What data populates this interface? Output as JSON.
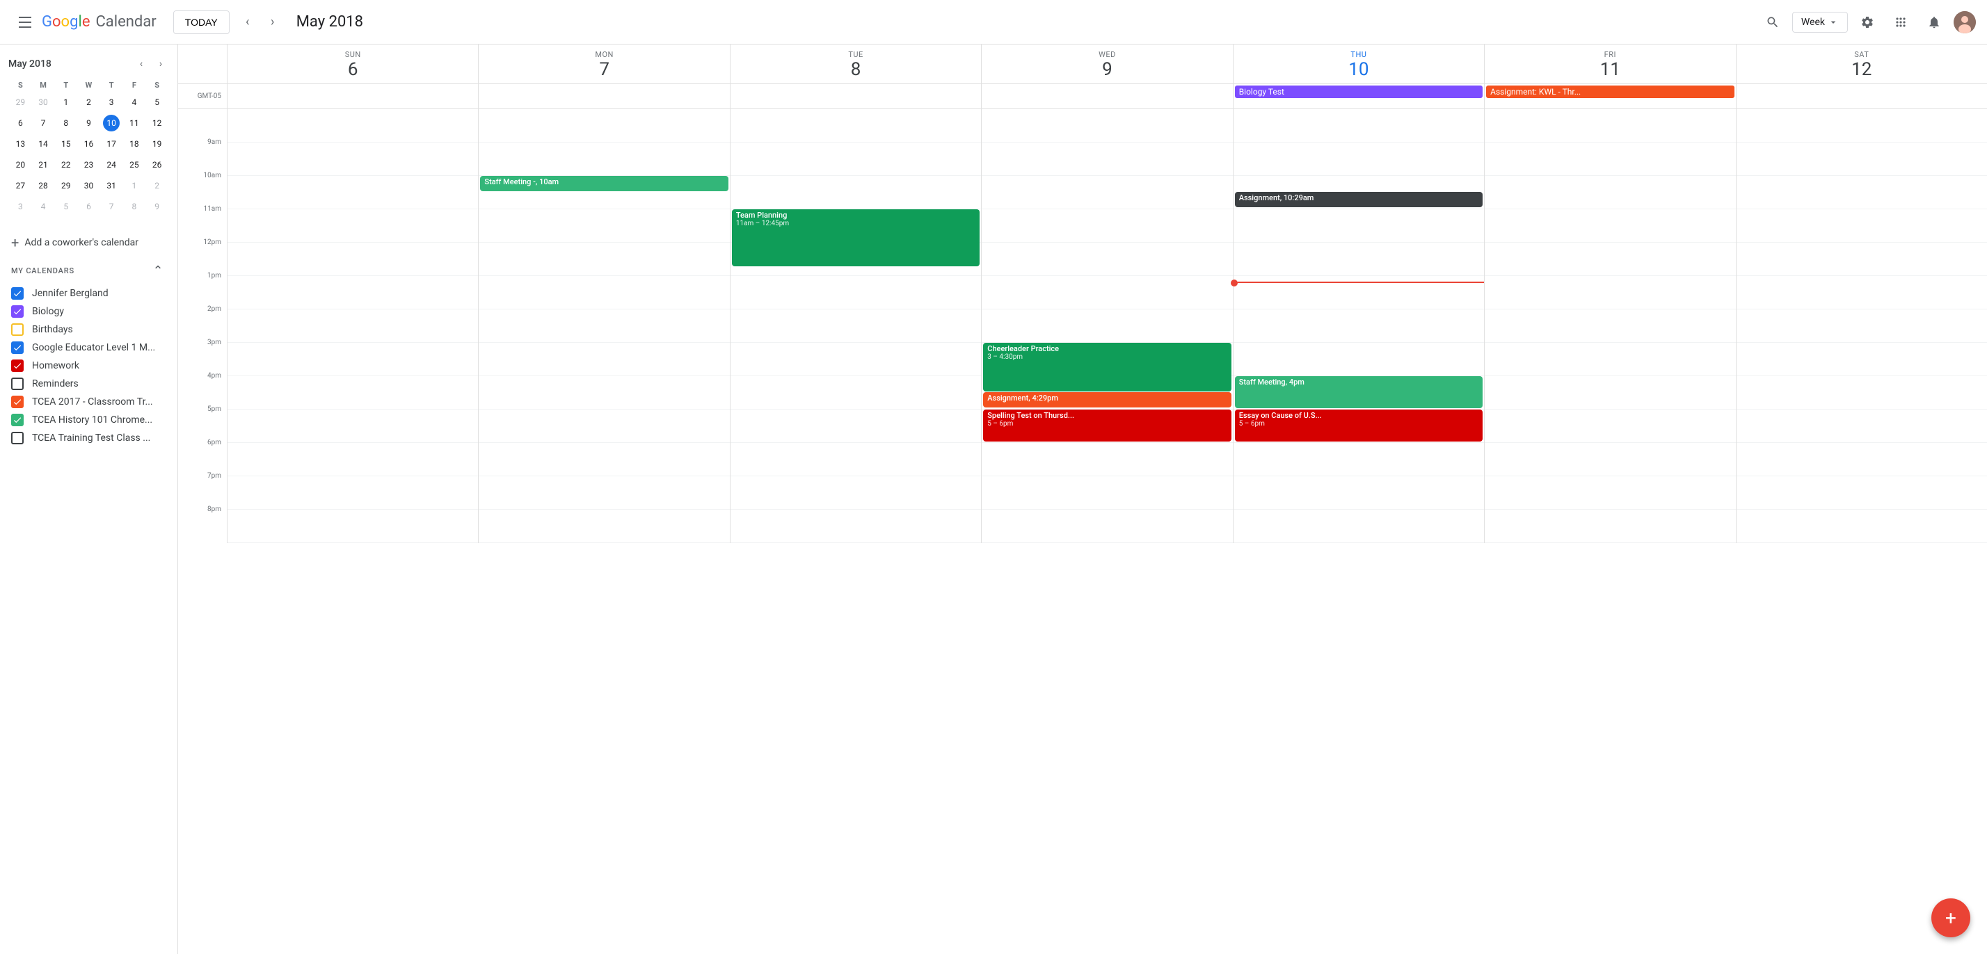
{
  "topbar": {
    "today_label": "TODAY",
    "current_period": "May 2018",
    "view_selector": "Week",
    "logo_text": "Google",
    "calendar_text": "Calendar"
  },
  "mini_cal": {
    "title": "May 2018",
    "days_of_week": [
      "S",
      "M",
      "T",
      "W",
      "T",
      "F",
      "S"
    ],
    "weeks": [
      [
        {
          "d": "29",
          "other": true
        },
        {
          "d": "30",
          "other": true
        },
        {
          "d": "1"
        },
        {
          "d": "2"
        },
        {
          "d": "3"
        },
        {
          "d": "4"
        },
        {
          "d": "5"
        }
      ],
      [
        {
          "d": "6"
        },
        {
          "d": "7"
        },
        {
          "d": "8"
        },
        {
          "d": "9"
        },
        {
          "d": "10",
          "today": true
        },
        {
          "d": "11"
        },
        {
          "d": "12"
        }
      ],
      [
        {
          "d": "13"
        },
        {
          "d": "14"
        },
        {
          "d": "15"
        },
        {
          "d": "16"
        },
        {
          "d": "17"
        },
        {
          "d": "18"
        },
        {
          "d": "19"
        }
      ],
      [
        {
          "d": "20"
        },
        {
          "d": "21"
        },
        {
          "d": "22"
        },
        {
          "d": "23"
        },
        {
          "d": "24"
        },
        {
          "d": "25"
        },
        {
          "d": "26"
        }
      ],
      [
        {
          "d": "27"
        },
        {
          "d": "28"
        },
        {
          "d": "29"
        },
        {
          "d": "30"
        },
        {
          "d": "31"
        },
        {
          "d": "1",
          "other": true
        },
        {
          "d": "2",
          "other": true
        }
      ],
      [
        {
          "d": "3",
          "other": true
        },
        {
          "d": "4",
          "other": true
        },
        {
          "d": "5",
          "other": true
        },
        {
          "d": "6",
          "other": true
        },
        {
          "d": "7",
          "other": true
        },
        {
          "d": "8",
          "other": true
        },
        {
          "d": "9",
          "other": true
        }
      ]
    ]
  },
  "coworker_cal": {
    "label": "Add a coworker's calendar"
  },
  "my_calendars": {
    "section_label": "My calendars",
    "items": [
      {
        "name": "Jennifer Bergland",
        "color": "#1a73e8",
        "checked": true
      },
      {
        "name": "Biology",
        "color": "#7c4dff",
        "checked": true
      },
      {
        "name": "Birthdays",
        "color": "#f6bf26",
        "checked": false,
        "outline": true
      },
      {
        "name": "Google Educator Level 1 M...",
        "color": "#1a73e8",
        "checked": true
      },
      {
        "name": "Homework",
        "color": "#d50000",
        "checked": true
      },
      {
        "name": "Reminders",
        "color": "#ffffff",
        "checked": false,
        "outline": true,
        "outline_color": "#3c4043"
      },
      {
        "name": "TCEA 2017 - Classroom Tr...",
        "color": "#f4511e",
        "checked": true
      },
      {
        "name": "TCEA History 101 Chrome...",
        "color": "#33b679",
        "checked": true
      },
      {
        "name": "TCEA Training Test Class ...",
        "color": "#ffffff",
        "checked": false,
        "outline": true,
        "outline_color": "#3c4043"
      }
    ]
  },
  "day_headers": [
    {
      "day_name": "Sun",
      "day_num": "6",
      "today": false
    },
    {
      "day_name": "Mon",
      "day_num": "7",
      "today": false
    },
    {
      "day_name": "Tue",
      "day_num": "8",
      "today": false
    },
    {
      "day_name": "Wed",
      "day_num": "9",
      "today": false
    },
    {
      "day_name": "Thu",
      "day_num": "10",
      "today": true
    },
    {
      "day_name": "Fri",
      "day_num": "11",
      "today": false
    },
    {
      "day_name": "Sat",
      "day_num": "12",
      "today": false
    }
  ],
  "allday_events": [
    {
      "col": 4,
      "title": "Biology Test",
      "color": "#7c4dff"
    },
    {
      "col": 5,
      "title": "Assignment: KWL - Thr...",
      "color": "#f4511e"
    }
  ],
  "time_labels": [
    "",
    "9am",
    "10am",
    "11am",
    "12pm",
    "1pm",
    "2pm",
    "3pm",
    "4pm",
    "5pm",
    "6pm",
    "7pm"
  ],
  "gmt_label": "GMT-05",
  "events": [
    {
      "col": 1,
      "title": "Staff Meeting -, 10am",
      "color": "#33b679",
      "top_hour": 10,
      "top_min": 0,
      "duration_min": 30
    },
    {
      "col": 2,
      "title": "Team Planning",
      "subtitle": "11am – 12:45pm",
      "color": "#0f9d58",
      "top_hour": 11,
      "top_min": 0,
      "duration_min": 105
    },
    {
      "col": 3,
      "title": "Cheerleader Practice",
      "subtitle": "3 – 4:30pm",
      "color": "#0f9d58",
      "top_hour": 15,
      "top_min": 0,
      "duration_min": 90
    },
    {
      "col": 3,
      "title": "Assignment, 4:29pm",
      "color": "#f4511e",
      "top_hour": 16,
      "top_min": 29,
      "duration_min": 30
    },
    {
      "col": 3,
      "title": "Spelling Test on Thursd...",
      "subtitle": "5 – 6pm",
      "color": "#d50000",
      "top_hour": 17,
      "top_min": 0,
      "duration_min": 60
    },
    {
      "col": 4,
      "title": "Assignment, 10:29am",
      "color": "#3c4043",
      "top_hour": 10,
      "top_min": 29,
      "duration_min": 30
    },
    {
      "col": 4,
      "title": "Staff Meeting, 4pm",
      "color": "#33b679",
      "top_hour": 16,
      "top_min": 0,
      "duration_min": 60
    },
    {
      "col": 4,
      "title": "Essay on Cause of U.S...",
      "subtitle": "5 – 6pm",
      "color": "#d50000",
      "top_hour": 17,
      "top_min": 0,
      "duration_min": 60
    }
  ],
  "current_time": {
    "hour": 13,
    "min": 10,
    "col": 4
  }
}
